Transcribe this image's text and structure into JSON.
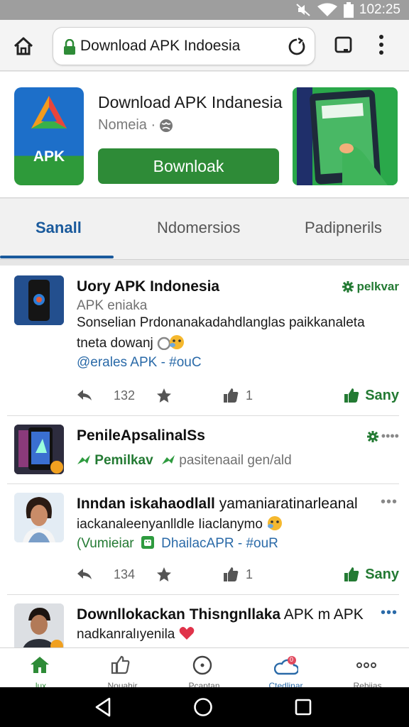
{
  "status_bar": {
    "time": "102:25",
    "icons": [
      "mute-icon",
      "wifi-icon",
      "battery-icon"
    ]
  },
  "browser": {
    "url_text": "Download APK Indoesia",
    "icons": [
      "home-icon",
      "lock-icon",
      "reload-icon",
      "tabs-icon",
      "menu-icon"
    ]
  },
  "app": {
    "icon_label": "APK",
    "title": "Download APK Indanesia",
    "subtitle": "Nomeia ·",
    "button_label": "Bownloak"
  },
  "tabs": [
    {
      "label": "Sanall",
      "active": true
    },
    {
      "label": "Ndomersios",
      "active": false
    },
    {
      "label": "Padipnerils",
      "active": false
    }
  ],
  "posts": [
    {
      "title": "Uory APK Indonesia",
      "badge": "pelkvar",
      "line1": "APK eniaka",
      "line2": "Sonselian Prdonanakadahdlanglas paikkanaleta",
      "line3": "tneta dowanj",
      "line4": "@erales APK - #ouC",
      "share_count": "132",
      "like_count": "1",
      "sany_label": "Sany"
    },
    {
      "title": "PenileApsalinalSs",
      "dots": "••••",
      "tag1": "Pemilkav",
      "tag2": "pasitenaail gen/ald"
    },
    {
      "title": "Inndan iskahaodlall",
      "title_rest": " yamaniaratinarleanal",
      "dots": "•••",
      "line2": "iackanaleenyanlldle Iiaclanymo",
      "line3a": "(Vumieiar",
      "line3b": "DhailacAPR - #ouR",
      "share_count": "134",
      "like_count": "1",
      "sany_label": "Sany"
    },
    {
      "title": "Downllokackan Thisngnllaka",
      "title_rest": " APK m APK",
      "dots": "•••",
      "line2": "nadkanralıyenila"
    }
  ],
  "bottom_nav": [
    {
      "label": "lux",
      "icon": "home-icon",
      "active": true
    },
    {
      "label": "Nouahir",
      "icon": "thumbs-up-outline-icon",
      "active": false
    },
    {
      "label": "Pcaptan",
      "icon": "compass-icon",
      "active": false
    },
    {
      "label": "Ctedlinar",
      "icon": "cloud-bell-icon",
      "active": false,
      "badge": "0"
    },
    {
      "label": "Rebiias",
      "icon": "more-icon",
      "active": false
    }
  ],
  "colors": {
    "accent_green": "#2e8b37",
    "accent_blue": "#1a5a9c"
  }
}
